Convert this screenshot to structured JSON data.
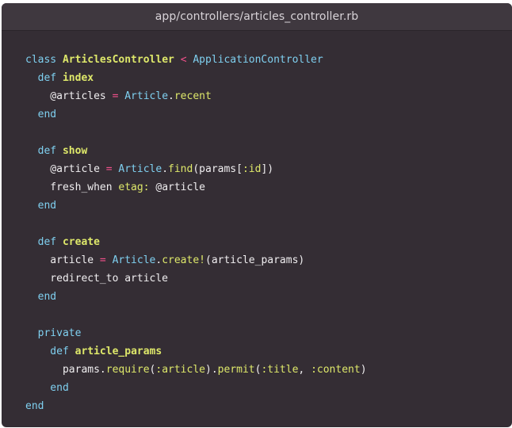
{
  "window": {
    "title": "app/controllers/articles_controller.rb"
  },
  "code": {
    "language": "ruby",
    "colors": {
      "background": "#342d34",
      "titlebar": "#3f383f",
      "keyword": "#7fd0f0",
      "definition": "#dee86a",
      "operator": "#f0508a",
      "text": "#f0eef0"
    },
    "lines": [
      [
        {
          "t": "class ",
          "c": "keyword"
        },
        {
          "t": "ArticlesController",
          "c": "class"
        },
        {
          "t": " ",
          "c": "plain"
        },
        {
          "t": "<",
          "c": "operator"
        },
        {
          "t": " ",
          "c": "plain"
        },
        {
          "t": "ApplicationController",
          "c": "constant"
        }
      ],
      [
        {
          "t": "  def ",
          "c": "keyword"
        },
        {
          "t": "index",
          "c": "method"
        }
      ],
      [
        {
          "t": "    @articles ",
          "c": "plain"
        },
        {
          "t": "=",
          "c": "operator"
        },
        {
          "t": " ",
          "c": "plain"
        },
        {
          "t": "Article",
          "c": "constant"
        },
        {
          "t": ".",
          "c": "plain"
        },
        {
          "t": "recent",
          "c": "call"
        }
      ],
      [
        {
          "t": "  end",
          "c": "keyword"
        }
      ],
      [],
      [
        {
          "t": "  def ",
          "c": "keyword"
        },
        {
          "t": "show",
          "c": "method"
        }
      ],
      [
        {
          "t": "    @article ",
          "c": "plain"
        },
        {
          "t": "=",
          "c": "operator"
        },
        {
          "t": " ",
          "c": "plain"
        },
        {
          "t": "Article",
          "c": "constant"
        },
        {
          "t": ".",
          "c": "plain"
        },
        {
          "t": "find",
          "c": "call"
        },
        {
          "t": "(params[",
          "c": "plain"
        },
        {
          "t": ":id",
          "c": "symbol"
        },
        {
          "t": "])",
          "c": "plain"
        }
      ],
      [
        {
          "t": "    fresh_when ",
          "c": "plain"
        },
        {
          "t": "etag:",
          "c": "symbol"
        },
        {
          "t": " @article",
          "c": "plain"
        }
      ],
      [
        {
          "t": "  end",
          "c": "keyword"
        }
      ],
      [],
      [
        {
          "t": "  def ",
          "c": "keyword"
        },
        {
          "t": "create",
          "c": "method"
        }
      ],
      [
        {
          "t": "    article ",
          "c": "plain"
        },
        {
          "t": "=",
          "c": "operator"
        },
        {
          "t": " ",
          "c": "plain"
        },
        {
          "t": "Article",
          "c": "constant"
        },
        {
          "t": ".",
          "c": "plain"
        },
        {
          "t": "create!",
          "c": "call"
        },
        {
          "t": "(article_params)",
          "c": "plain"
        }
      ],
      [
        {
          "t": "    redirect_to article",
          "c": "plain"
        }
      ],
      [
        {
          "t": "  end",
          "c": "keyword"
        }
      ],
      [],
      [
        {
          "t": "  private",
          "c": "keyword"
        }
      ],
      [
        {
          "t": "    def ",
          "c": "keyword"
        },
        {
          "t": "article_params",
          "c": "method"
        }
      ],
      [
        {
          "t": "      params",
          "c": "plain"
        },
        {
          "t": ".",
          "c": "plain"
        },
        {
          "t": "require",
          "c": "call"
        },
        {
          "t": "(",
          "c": "plain"
        },
        {
          "t": ":article",
          "c": "symbol"
        },
        {
          "t": ").",
          "c": "plain"
        },
        {
          "t": "permit",
          "c": "call"
        },
        {
          "t": "(",
          "c": "plain"
        },
        {
          "t": ":title",
          "c": "symbol"
        },
        {
          "t": ", ",
          "c": "plain"
        },
        {
          "t": ":content",
          "c": "symbol"
        },
        {
          "t": ")",
          "c": "plain"
        }
      ],
      [
        {
          "t": "    end",
          "c": "keyword"
        }
      ],
      [
        {
          "t": "end",
          "c": "keyword"
        }
      ]
    ]
  }
}
